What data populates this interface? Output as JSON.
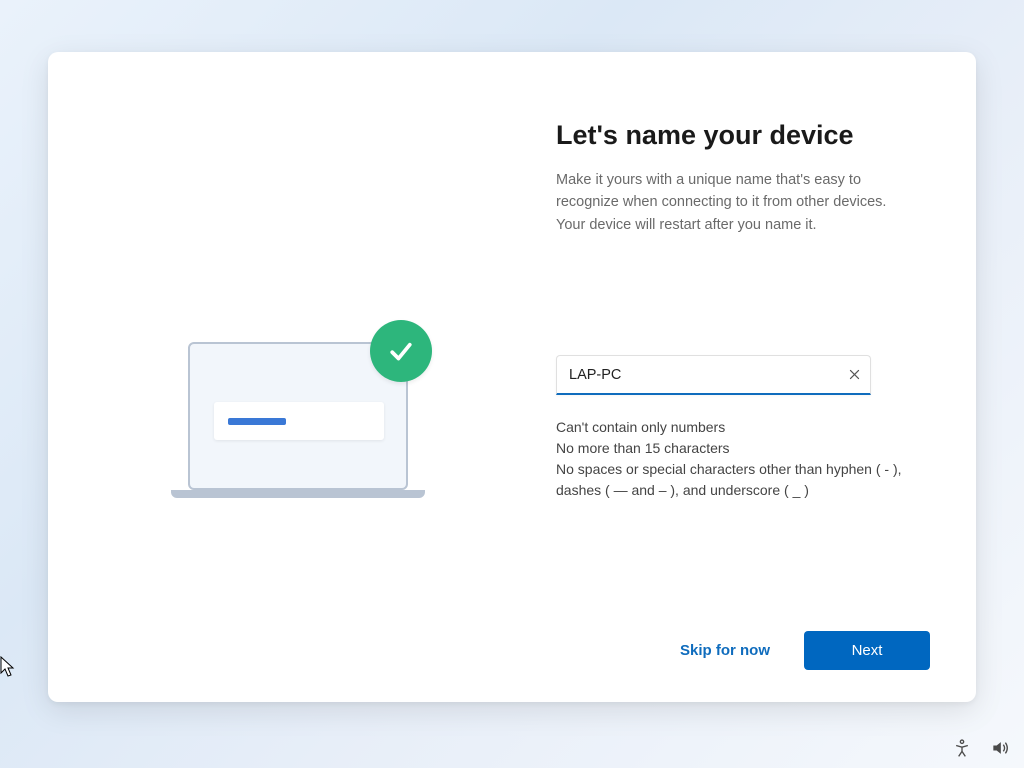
{
  "heading": "Let's name your device",
  "subheading": "Make it yours with a unique name that's easy to recognize when connecting to it from other devices. Your device will restart after you name it.",
  "deviceName": {
    "value": "LAP-PC"
  },
  "rules": {
    "line1": "Can't contain only numbers",
    "line2": "No more than 15 characters",
    "line3": "No spaces or special characters other than hyphen ( - ), dashes ( — and – ), and underscore ( _ )"
  },
  "buttons": {
    "skip": "Skip for now",
    "next": "Next"
  },
  "colors": {
    "accent": "#0067c0",
    "badge": "#2db67c"
  }
}
